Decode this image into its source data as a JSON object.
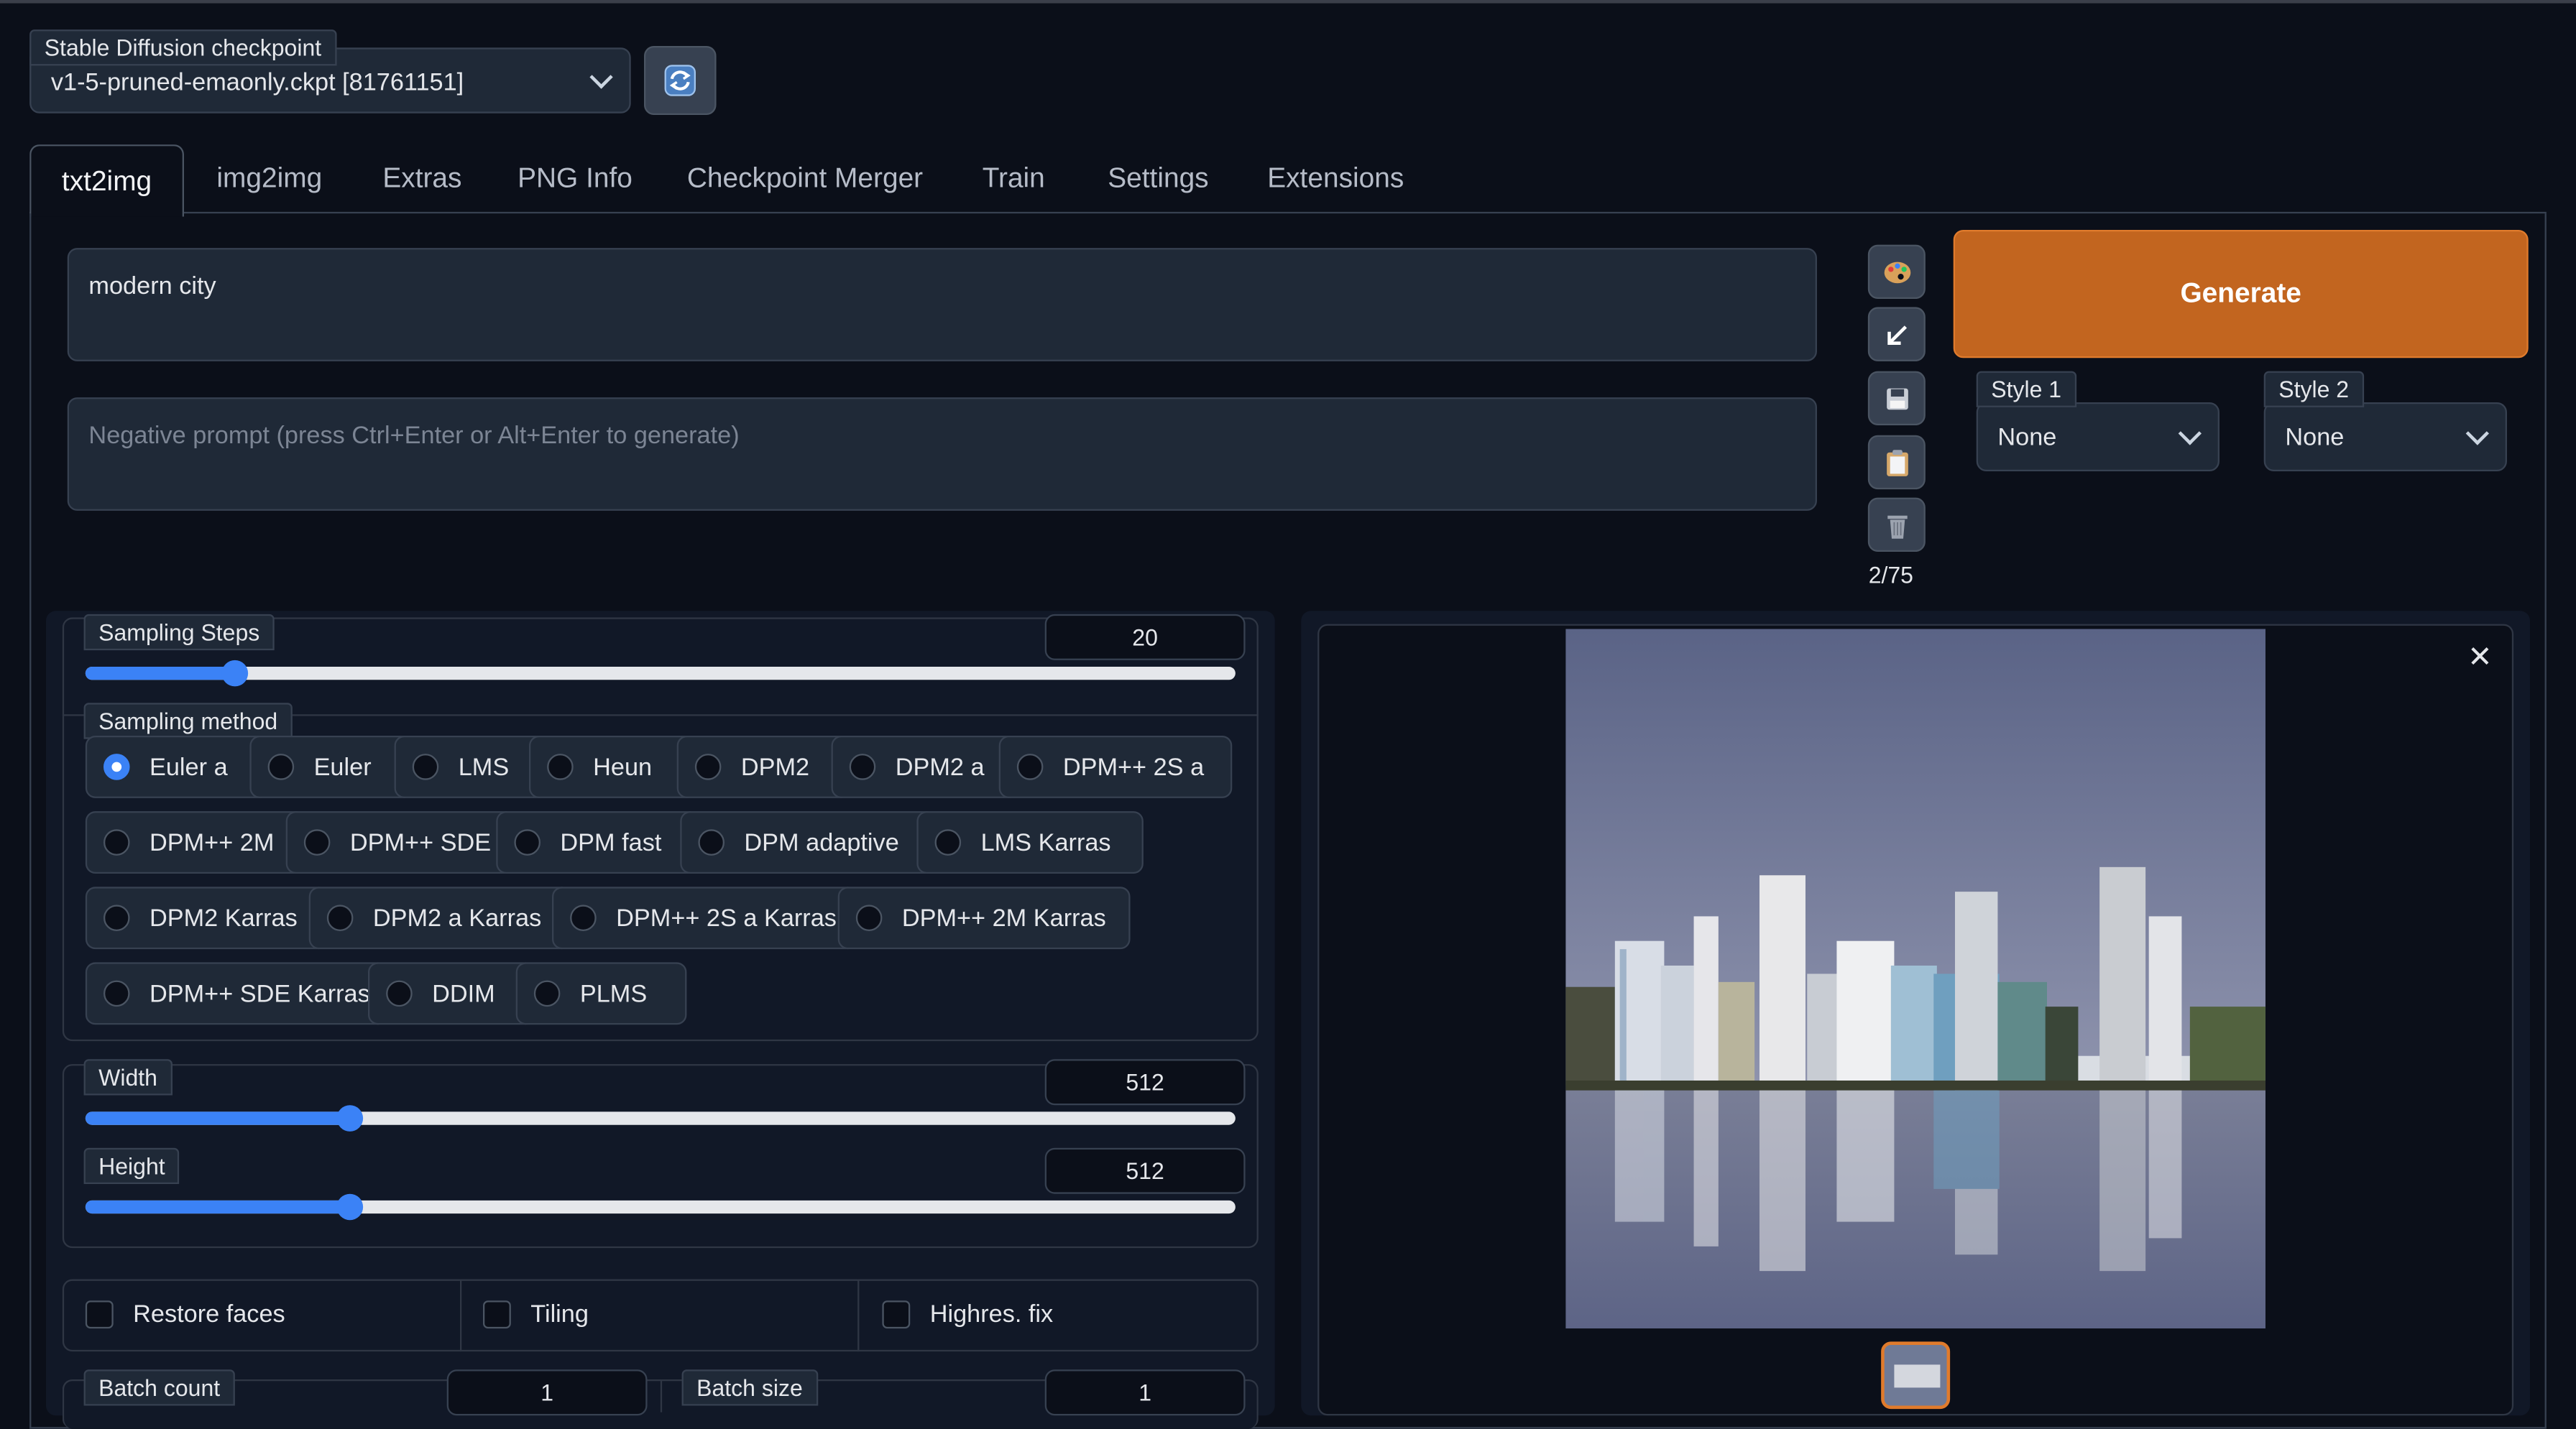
{
  "checkpoint": {
    "label": "Stable Diffusion checkpoint",
    "value": "v1-5-pruned-emaonly.ckpt [81761151]",
    "refresh_icon": "refresh-icon"
  },
  "tabs": [
    "txt2img",
    "img2img",
    "Extras",
    "PNG Info",
    "Checkpoint Merger",
    "Train",
    "Settings",
    "Extensions"
  ],
  "prompt": {
    "value": "modern city"
  },
  "negative_prompt": {
    "placeholder": "Negative prompt (press Ctrl+Enter or Alt+Enter to generate)"
  },
  "tools": {
    "icons": [
      "palette-icon",
      "arrow-down-left-icon",
      "save-icon",
      "clipboard-icon",
      "trash-icon"
    ],
    "token_count": "2/75"
  },
  "generate": {
    "label": "Generate",
    "color": "#c2651f"
  },
  "styles": [
    {
      "label": "Style 1",
      "value": "None"
    },
    {
      "label": "Style 2",
      "value": "None"
    }
  ],
  "sampling_steps": {
    "label": "Sampling Steps",
    "value": "20",
    "fraction": 0.13
  },
  "sampling_method": {
    "label": "Sampling method",
    "selected": "Euler a",
    "options": [
      "Euler a",
      "Euler",
      "LMS",
      "Heun",
      "DPM2",
      "DPM2 a",
      "DPM++ 2S a",
      "DPM++ 2M",
      "DPM++ SDE",
      "DPM fast",
      "DPM adaptive",
      "LMS Karras",
      "DPM2 Karras",
      "DPM2 a Karras",
      "DPM++ 2S a Karras",
      "DPM++ 2M Karras",
      "DPM++ SDE Karras",
      "DDIM",
      "PLMS"
    ]
  },
  "width": {
    "label": "Width",
    "value": "512",
    "fraction": 0.23
  },
  "height": {
    "label": "Height",
    "value": "512",
    "fraction": 0.23
  },
  "checkboxes": [
    "Restore faces",
    "Tiling",
    "Highres. fix"
  ],
  "batch_count": {
    "label": "Batch count",
    "value": "1"
  },
  "batch_size": {
    "label": "Batch size",
    "value": "1"
  },
  "gallery": {
    "close_icon": "close-icon",
    "image_desc_icon": "city-skyline-image"
  },
  "accent": "#3b82f6"
}
